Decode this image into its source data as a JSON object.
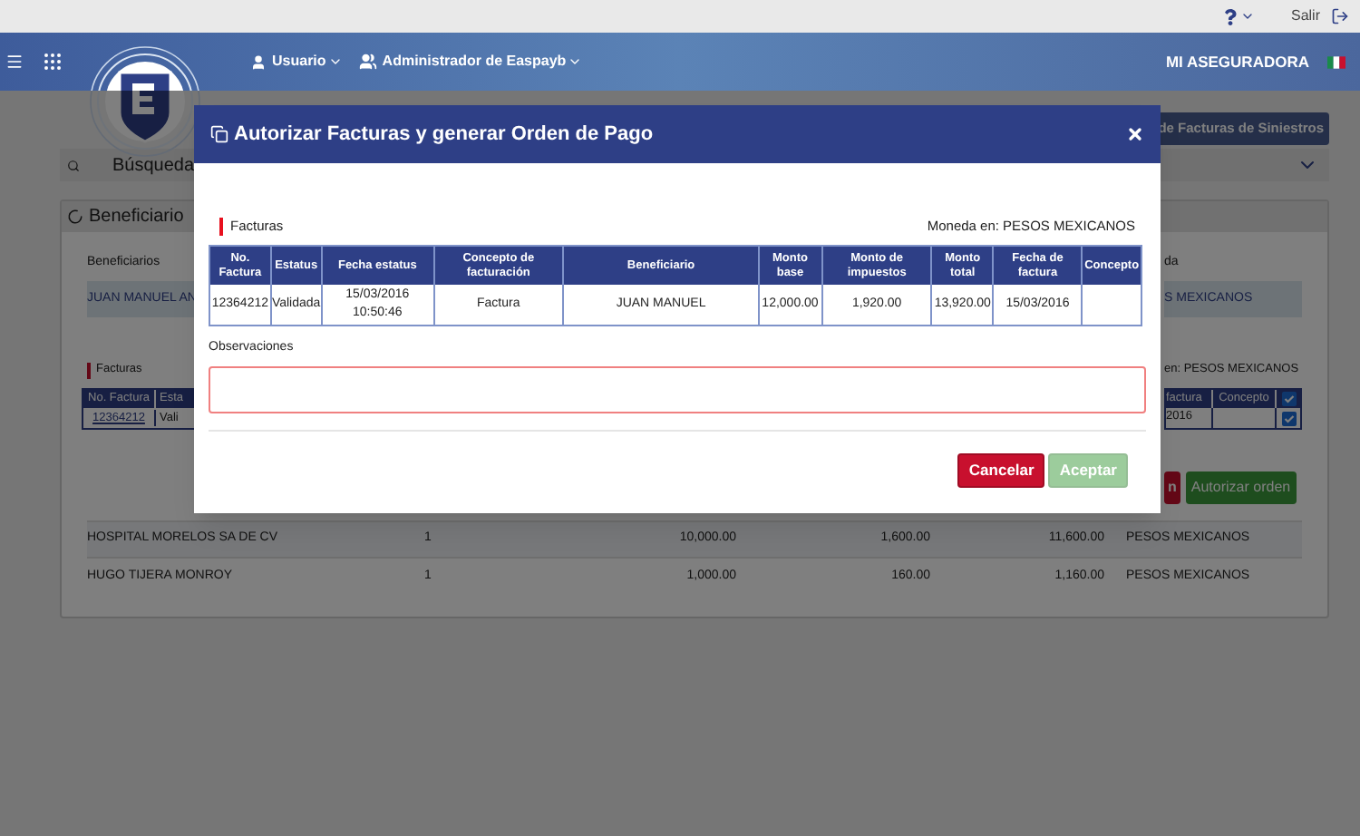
{
  "top_bar": {
    "logout": "Salir"
  },
  "header": {
    "user_menu": "Usuario",
    "admin_menu": "Administrador de Easpayb",
    "company": "MI ASEGURADORA"
  },
  "page": {
    "siniestros_button": "de Facturas de Siniestros",
    "search": {
      "label": "Búsqueda"
    },
    "panel": {
      "title": "Beneficiario",
      "beneficiaries_label": "Beneficiarios",
      "currency_label": "da",
      "selected_row": {
        "name": "JUAN MANUEL AN",
        "currency": "S MEXICANOS"
      },
      "facturas_label": "Facturas",
      "currency_note": "en: PESOS MEXICANOS",
      "left_table": {
        "columns": [
          "No. Factura",
          "Esta"
        ],
        "row": [
          "12364212",
          "Vali"
        ]
      },
      "right_table": {
        "columns": [
          "factura",
          "Concepto"
        ],
        "header_checked": true,
        "row": [
          "2016"
        ],
        "row_checked": true
      },
      "reject_button": "n",
      "authorize_button": "Autorizar orden",
      "rows": [
        {
          "cells": [
            "HOSPITAL MORELOS SA DE CV",
            "1",
            "10,000.00",
            "1,600.00",
            "11,600.00",
            "PESOS MEXICANOS"
          ],
          "highlighted": true
        },
        {
          "cells": [
            "HUGO TIJERA MONROY",
            "1",
            "1,000.00",
            "160.00",
            "1,160.00",
            "PESOS MEXICANOS"
          ],
          "highlighted": false
        }
      ]
    }
  },
  "modal": {
    "title": "Autorizar Facturas y generar Orden de Pago",
    "section": "Facturas",
    "currency_note": "Moneda en: PESOS MEXICANOS",
    "table": {
      "columns": [
        "No. Factura",
        "Estatus",
        "Fecha estatus",
        "Concepto de facturación",
        "Beneficiario",
        "Monto base",
        "Monto de impuestos",
        "Monto total",
        "Fecha de factura",
        "Concepto"
      ],
      "rows": [
        {
          "cells": [
            "12364212",
            "Validada",
            "15/03/2016 10:50:46",
            "Factura",
            "JUAN MANUEL",
            "12,000.00",
            "1,920.00",
            "13,920.00",
            "15/03/2016"
          ]
        }
      ]
    },
    "observations_label": "Observaciones",
    "buttons": [
      {
        "label": "Cancelar",
        "kind": "cancel",
        "disabled": false
      },
      {
        "label": "Aceptar",
        "kind": "accept",
        "disabled": true
      }
    ]
  }
}
